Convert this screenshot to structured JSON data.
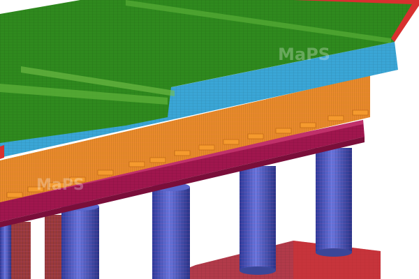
{
  "watermark": {
    "text": "MaPS"
  },
  "render_colors": {
    "deck_top": "#2f8a1e",
    "deck_side": "#3aa6d6",
    "girder_web": "#e88a2a",
    "bearing": "#f59a2e",
    "pier_cap": "#a0164e",
    "column": "#4a58c8",
    "column_red": "#9a3a3a",
    "footing": "#b23a4a",
    "edge_red": "#d8302f"
  }
}
